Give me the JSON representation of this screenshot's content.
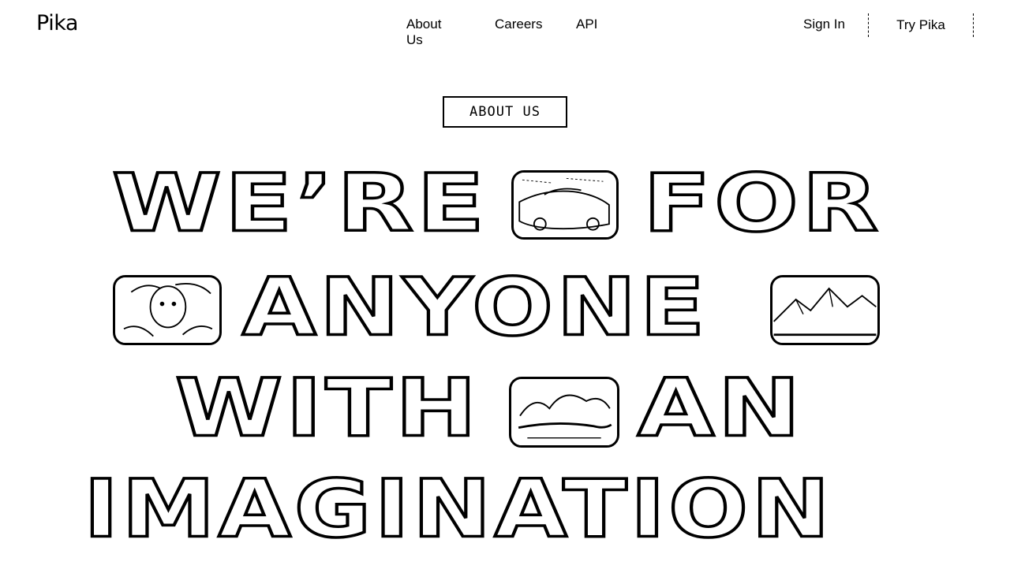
{
  "nav": {
    "logo": "Pika",
    "links": [
      "About Us",
      "Careers",
      "API"
    ],
    "sign_in": "Sign In",
    "try_button": "Try Pika"
  },
  "hero": {
    "eyebrow": "ABOUT US",
    "lines": [
      [
        "WE’RE",
        "FOR"
      ],
      [
        "ANYONE"
      ],
      [
        "WITH",
        "AN"
      ],
      [
        "IMAGINATION"
      ]
    ]
  }
}
